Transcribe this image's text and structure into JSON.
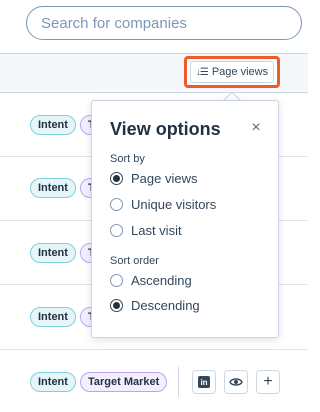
{
  "search": {
    "placeholder": "Search for companies"
  },
  "sort_button": {
    "label": "Page views",
    "icon": "sort-icon"
  },
  "rows": [
    {
      "badges": [
        "Intent",
        "T"
      ]
    },
    {
      "badges": [
        "Intent",
        "T"
      ]
    },
    {
      "badges": [
        "Intent",
        "T"
      ]
    },
    {
      "badges": [
        "Intent",
        "T"
      ]
    },
    {
      "badges": [
        "Intent",
        "Target Market"
      ]
    }
  ],
  "popover": {
    "title": "View options",
    "close_icon": "×",
    "sort_by": {
      "label": "Sort by",
      "options": [
        "Page views",
        "Unique visitors",
        "Last visit"
      ],
      "selected": "Page views"
    },
    "sort_order": {
      "label": "Sort order",
      "options": [
        "Ascending",
        "Descending"
      ],
      "selected": "Descending"
    }
  },
  "row_actions": {
    "linkedin_icon": "in",
    "view_icon": "eye-icon",
    "add_icon": "+"
  },
  "colors": {
    "highlight": "#ef5a2a",
    "intent": "#e5f5f8",
    "target": "#f3efff"
  }
}
